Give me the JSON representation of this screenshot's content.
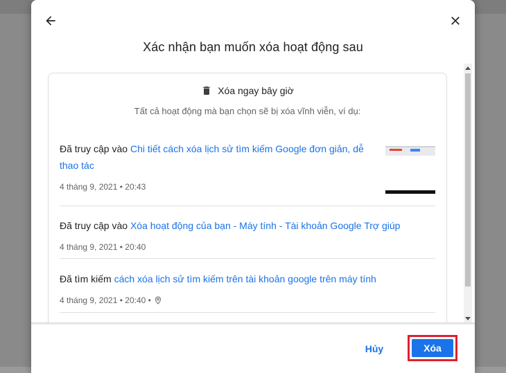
{
  "dialog": {
    "title": "Xác nhận bạn muốn xóa hoạt động sau"
  },
  "card": {
    "heading": "Xóa ngay bây giờ",
    "subtitle": "Tất cả hoạt động mà bạn chọn sẽ bị xóa vĩnh viễn, ví dụ:"
  },
  "activities": [
    {
      "prefix": "Đã truy cập vào",
      "link": "Chi tiết cách xóa lịch sử tìm kiếm Google đơn giản, dễ thao tác",
      "timestamp": "4 tháng 9, 2021 • 20:43"
    },
    {
      "prefix": "Đã truy cập vào",
      "link": "Xóa hoạt động của bạn - Máy tính - Tài khoản Google Trợ giúp",
      "timestamp": "4 tháng 9, 2021 • 20:40"
    },
    {
      "prefix": "Đã tìm kiếm",
      "link": "cách xóa lịch sử tìm kiếm trên tài khoản google trên máy tính",
      "timestamp": "4 tháng 9, 2021 • 20:40 •"
    }
  ],
  "footer": {
    "cancel_label": "Hủy",
    "delete_label": "Xóa"
  },
  "colors": {
    "accent": "#1a73e8",
    "highlight_outline": "#e0202d"
  },
  "icons": {
    "back": "arrow-back-icon",
    "close": "close-icon",
    "trash": "trash-icon",
    "location": "location-pin-icon"
  }
}
